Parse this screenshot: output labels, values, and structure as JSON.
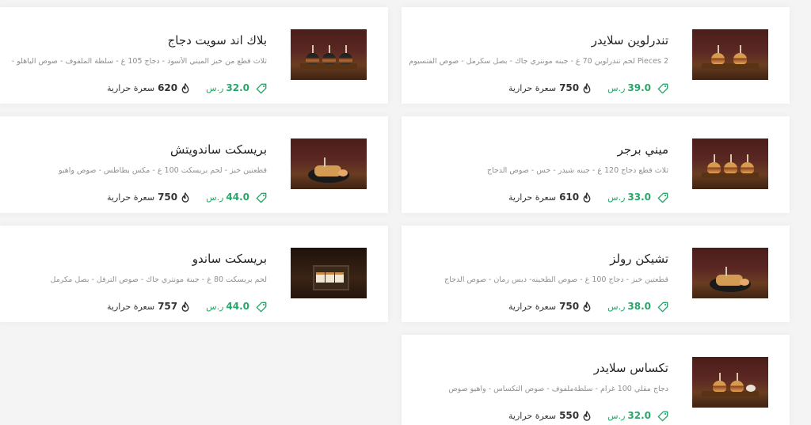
{
  "currency": "ر.س",
  "calorie_label": "سعرة حرارية",
  "items": [
    {
      "name": "تندرلوين سلايدر",
      "desc": "2 Pieces لحم تندرلوين 70 غ - جبنه مونتري جاك - بصل سكرمل - صوص الفتسيوم",
      "price": "39.0",
      "calories": "750",
      "thumb": "sliders-two"
    },
    {
      "name": "بلاك اند سويت دجاج",
      "desc": "ثلاث قطع من خبز الميني الأسود - دجاج 105 غ - سلطة الملفوف - صوص الياهلو -",
      "price": "32.0",
      "calories": "620",
      "thumb": "sliders-black"
    },
    {
      "name": "ميني برجر",
      "desc": "ثلاث قطع دجاج 120 غ - جبنه شيدر - خس - صوص الدجاج",
      "price": "33.0",
      "calories": "610",
      "thumb": "mini-burgers"
    },
    {
      "name": "بريسكت ساندويتش",
      "desc": "قطعتين خبز - لحم بريسكت 100 غ - مكس بطاطس - صوص واهيو",
      "price": "44.0",
      "calories": "750",
      "thumb": "plate-wrap"
    },
    {
      "name": "تشيكن رولز",
      "desc": "قطعتين خبز - دجاج 100 غ - صوص الطحينه- دبس رمان - صوص الدجاج",
      "price": "38.0",
      "calories": "750",
      "thumb": "plate-wrap"
    },
    {
      "name": "بريسكت ساندو",
      "desc": "لحم بريسكت 80 غ - جبنة مونتري جاك - صوص الترفل - بصل مكرمل",
      "price": "44.0",
      "calories": "757",
      "thumb": "box-sando"
    },
    {
      "name": "تكساس سلايدر",
      "desc": "دجاج مقلي 100 غرام - سلطةملفوف - صوص التكساس - واهيو صوص",
      "price": "32.0",
      "calories": "550",
      "thumb": "sliders-two"
    }
  ]
}
